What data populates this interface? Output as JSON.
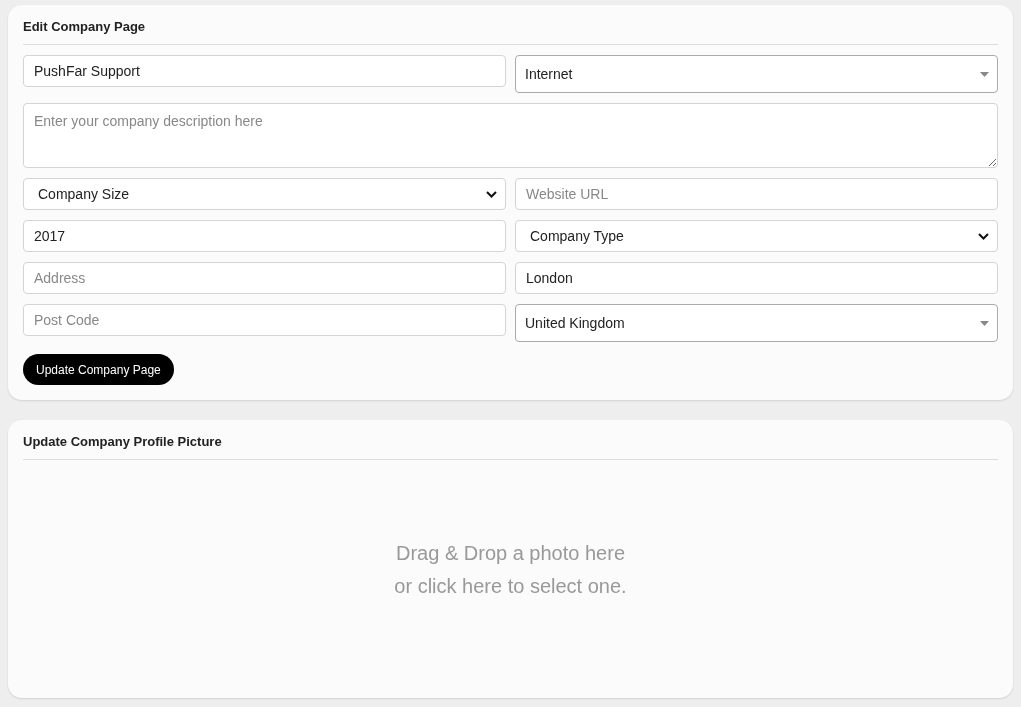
{
  "edit_card": {
    "title": "Edit Company Page",
    "fields": [
      {
        "kind": "input",
        "value": "PushFar Support"
      },
      {
        "kind": "combo",
        "value": "Internet"
      },
      {
        "kind": "textarea",
        "placeholder": "Enter your company description here"
      },
      {
        "kind": "select",
        "value": "Company Size"
      },
      {
        "kind": "input",
        "placeholder": "Website URL"
      },
      {
        "kind": "input",
        "value": "2017"
      },
      {
        "kind": "select",
        "value": "Company Type"
      },
      {
        "kind": "input",
        "placeholder": "Address"
      },
      {
        "kind": "input",
        "value": "London"
      },
      {
        "kind": "input",
        "placeholder": "Post Code"
      },
      {
        "kind": "combo",
        "value": "United Kingdom"
      }
    ],
    "button": "Update Company Page"
  },
  "picture_card": {
    "title": "Update Company Profile Picture",
    "dropzone": [
      "Drag & Drop a photo here",
      "or click here to select one."
    ]
  }
}
